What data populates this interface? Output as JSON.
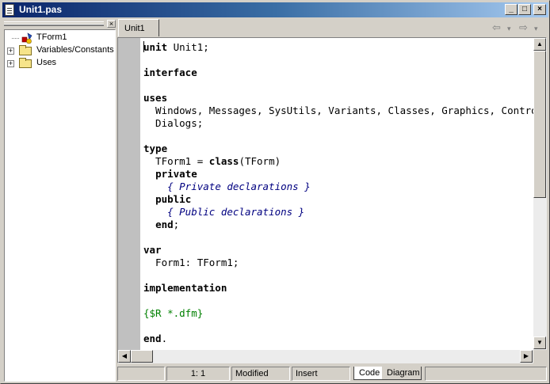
{
  "window": {
    "title": "Unit1.pas",
    "buttons": {
      "minimize": "_",
      "maximize": "□",
      "close": "×"
    }
  },
  "explorer": {
    "close_label": "×",
    "items": [
      {
        "label": "TForm1",
        "icon": "form-icon",
        "expandable": false
      },
      {
        "label": "Variables/Constants",
        "icon": "folder-icon",
        "expandable": true,
        "expander": "+"
      },
      {
        "label": "Uses",
        "icon": "folder-icon",
        "expandable": true,
        "expander": "+"
      }
    ]
  },
  "editor": {
    "tabs": [
      {
        "label": "Unit1",
        "active": true
      }
    ],
    "nav": {
      "back": "⇦",
      "back_dropdown": "▾",
      "forward": "⇨",
      "forward_dropdown": "▾"
    },
    "code_lines": [
      [
        {
          "t": "unit",
          "s": "kw"
        },
        {
          "t": " Unit1;"
        }
      ],
      [],
      [
        {
          "t": "interface",
          "s": "kw"
        }
      ],
      [],
      [
        {
          "t": "uses",
          "s": "kw"
        }
      ],
      [
        {
          "t": "  Windows, Messages, SysUtils, Variants, Classes, Graphics, Controls, Forms,"
        }
      ],
      [
        {
          "t": "  Dialogs;"
        }
      ],
      [],
      [
        {
          "t": "type",
          "s": "kw"
        }
      ],
      [
        {
          "t": "  TForm1 = "
        },
        {
          "t": "class",
          "s": "kw"
        },
        {
          "t": "(TForm)"
        }
      ],
      [
        {
          "t": "  "
        },
        {
          "t": "private",
          "s": "kw"
        }
      ],
      [
        {
          "t": "    "
        },
        {
          "t": "{ Private declarations }",
          "s": "cm"
        }
      ],
      [
        {
          "t": "  "
        },
        {
          "t": "public",
          "s": "kw"
        }
      ],
      [
        {
          "t": "    "
        },
        {
          "t": "{ Public declarations }",
          "s": "cm"
        }
      ],
      [
        {
          "t": "  "
        },
        {
          "t": "end",
          "s": "kw"
        },
        {
          "t": ";"
        }
      ],
      [],
      [
        {
          "t": "var",
          "s": "kw"
        }
      ],
      [
        {
          "t": "  Form1: TForm1;"
        }
      ],
      [],
      [
        {
          "t": "implementation",
          "s": "kw"
        }
      ],
      [],
      [
        {
          "t": "{$R *.dfm}",
          "s": "dir"
        }
      ],
      [],
      [
        {
          "t": "end",
          "s": "kw"
        },
        {
          "t": "."
        }
      ]
    ]
  },
  "status": {
    "position": "1:   1",
    "modified": "Modified",
    "mode": "Insert",
    "view_tabs": [
      "Code",
      "Diagram"
    ]
  },
  "scroll_arrows": {
    "up": "▲",
    "down": "▼",
    "left": "◀",
    "right": "▶"
  },
  "colors": {
    "title_gradient_start": "#0a246a",
    "title_gradient_end": "#a6caf0",
    "comment": "#000080",
    "directive": "#008000",
    "gutter": "#c0c0c0"
  }
}
